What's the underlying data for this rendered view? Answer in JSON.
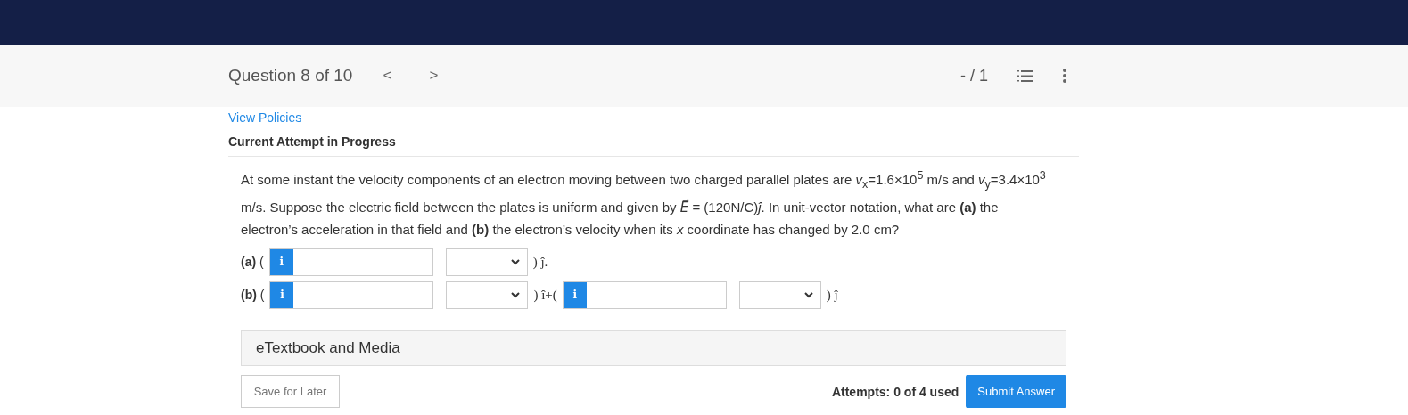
{
  "header": {
    "title": "Question 8 of 10",
    "prev": "<",
    "next": ">",
    "score": "- / 1"
  },
  "policies_link": "View Policies",
  "attempt_heading": "Current Attempt in Progress",
  "question": "At some instant the velocity components of an electron moving between two charged parallel plates are *v*$_{x}$=1.6×10$^{5}$ m/s and *v*$_{y}$=3.4×10$^{3}$ m/s. Suppose the electric field between the plates is uniform and given by *E⃗* = (120N/C)*ĵ*. In unit-vector notation, what are **(a)** the electron’s acceleration in that field and **(b)** the electron’s velocity when its *x* coordinate has changed by 2.0 cm?",
  "answer_rows": [
    {
      "parts": [
        {
          "kind": "label",
          "text": "**(a)** ("
        },
        {
          "kind": "input",
          "info": "i"
        },
        {
          "kind": "select"
        },
        {
          "kind": "text",
          "text": ") ĵ."
        }
      ]
    },
    {
      "parts": [
        {
          "kind": "label",
          "text": "**(b)** ("
        },
        {
          "kind": "input",
          "info": "i"
        },
        {
          "kind": "select"
        },
        {
          "kind": "text",
          "text": ") î+("
        },
        {
          "kind": "input",
          "info": "i"
        },
        {
          "kind": "select"
        },
        {
          "kind": "text",
          "text": ") ĵ"
        }
      ]
    }
  ],
  "media_panel": "eTextbook and Media",
  "save_button": "Save for Later",
  "attempts": "Attempts: 0 of 4 used",
  "submit_button": "Submit Answer"
}
